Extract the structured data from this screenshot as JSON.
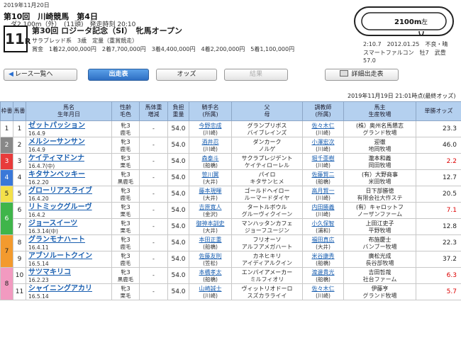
{
  "header": {
    "date": "2019年11月20日",
    "line1_main": "第10回　川崎競馬　第4日",
    "line1_sub": "ダ2,100m（外）　(11頭)　発走時刻 20:10",
    "race_number": "11",
    "race_suffix": "R",
    "race_name": "第30回 ロジータ記念（SⅠ）　牝馬オープン",
    "conditions": "サラブレッド系　3歳　定量（重賞競走）",
    "prize": "賞金　1着22,000,000円　2着7,700,000円　3着4,400,000円　4着2,200,000円　5着1,100,000円"
  },
  "course": {
    "distance": "2100m",
    "direction": "左",
    "record_lines": [
      "2:10.7　2012.01.25　不良・晴",
      "スマートファルコン　牡7　武豊",
      "57.0"
    ]
  },
  "toolbar": {
    "back": "レース一覧へ",
    "entries": "出走表",
    "odds": "オッズ",
    "results": "結果",
    "print": "詳細出走表"
  },
  "updated": "2019年11月19日 21:01時点(最終オッズ)",
  "colors": {
    "header_bg": "#b4d0ef",
    "link": "#1a5fb0",
    "odds_red": "#d00000",
    "waku": [
      "#ffffff",
      "#888888",
      "#e83b3b",
      "#3a78d8",
      "#f4e14a",
      "#3fb54a",
      "#f39a2e",
      "#f29ac0"
    ]
  },
  "columns": [
    "枠番",
    "馬番",
    "馬名\n生年月日",
    "性齢\n毛色",
    "馬体重\n増減",
    "負担\n重量",
    "騎手名\n(所属)",
    "父\n母",
    "調教師\n(所属)",
    "馬主\n生産牧場",
    "単勝オッズ"
  ],
  "rows": [
    {
      "waku": "1",
      "num": "1",
      "name": "ゼットパッション",
      "birth": "16.4.9",
      "sex": "牝3",
      "coat": "鹿毛",
      "wt": "-",
      "load": "54.0",
      "jockey": "今野忠成",
      "jaff": "(川崎)",
      "sire": "グランプリボス",
      "dam": "バイブレインズ",
      "trainer": "佐々木仁",
      "taff": "(川崎)",
      "owner": "(株）奥州名馬懇志",
      "breeder": "グランド牧場",
      "odds": "23.3",
      "red": false
    },
    {
      "waku": "2",
      "num": "2",
      "name": "メルシーサンサン",
      "birth": "16.4.9",
      "sex": "牝3",
      "coat": "鹿毛",
      "wt": "-",
      "load": "54.0",
      "jockey": "酒井忍",
      "jaff": "(川崎)",
      "sire": "ダンカーク",
      "dam": "ノルゲ",
      "trainer": "小澤宏次",
      "taff": "(川崎)",
      "owner": "迎徹",
      "breeder": "地岡牧場",
      "odds": "46.0",
      "red": false
    },
    {
      "waku": "3",
      "num": "3",
      "name": "ケイティマドンナ",
      "birth": "16.4.7(中)",
      "sex": "牝3",
      "coat": "栗毛",
      "wt": "-",
      "load": "54.0",
      "jockey": "森泰斗",
      "jaff": "(船橋)",
      "sire": "サクラプレジデント",
      "dam": "ケイティローレル",
      "trainer": "堀千亜樹",
      "taff": "(川崎)",
      "owner": "瀧本和義",
      "breeder": "岡田牧場",
      "odds": "2.2",
      "red": true
    },
    {
      "waku": "4",
      "num": "4",
      "name": "キタサンベッキー",
      "birth": "16.2.20",
      "sex": "牝3",
      "coat": "黒鹿毛",
      "wt": "-",
      "load": "54.0",
      "jockey": "笹川翼",
      "jaff": "(大井)",
      "sire": "パイロ",
      "dam": "キタサンヒメ",
      "trainer": "佐藤賢二",
      "taff": "(船橋)",
      "owner": "(有）大野商事",
      "breeder": "米田牧場",
      "odds": "12.7",
      "red": false
    },
    {
      "waku": "5",
      "num": "5",
      "name": "グローリアスライブ",
      "birth": "16.4.20",
      "sex": "牝3",
      "coat": "鹿毛",
      "wt": "-",
      "load": "54.0",
      "jockey": "藤本現暉",
      "jaff": "(大井)",
      "sire": "ゴールドヘイロー",
      "dam": "ルーマードダイヤ",
      "trainer": "高月賢一",
      "taff": "(川崎)",
      "owner": "日下部勝徳",
      "breeder": "有限会社大作ステ",
      "odds": "20.5",
      "red": false
    },
    {
      "waku": "6",
      "num": "6",
      "name": "リトミックグルーヴ",
      "birth": "16.4.2",
      "sex": "牝3",
      "coat": "栗毛",
      "wt": "-",
      "load": "54.0",
      "jockey": "吉原寛人",
      "jaff": "(金沢)",
      "sire": "タートルボウル",
      "dam": "グルーヴィクイーン",
      "trainer": "内田勝義",
      "taff": "(川崎)",
      "owner": "(有）キャロットフ",
      "breeder": "ノーザンファーム",
      "odds": "7.1",
      "red": true
    },
    {
      "waku": "6",
      "num": "7",
      "name": "ジョースイーツ",
      "birth": "16.3.14(中)",
      "sex": "牝3",
      "coat": "栗毛",
      "wt": "-",
      "load": "54.0",
      "jockey": "御神本訓史",
      "jaff": "(大井)",
      "sire": "マンハッタンカフェ",
      "dam": "ジョーフユージン",
      "trainer": "小久保智",
      "taff": "(浦和)",
      "owner": "上田江吏子",
      "breeder": "平野牧場",
      "odds": "12.8",
      "red": false
    },
    {
      "waku": "7",
      "num": "8",
      "name": "グランモナハート",
      "birth": "16.4.11",
      "sex": "牝3",
      "coat": "鹿毛",
      "wt": "-",
      "load": "54.0",
      "jockey": "本田正重",
      "jaff": "(船橋)",
      "sire": "フリオーソ",
      "dam": "アルフアメガハート",
      "trainer": "福田真広",
      "taff": "(大井)",
      "owner": "布施慶士",
      "breeder": "バンブー牧場",
      "odds": "22.3",
      "red": false
    },
    {
      "waku": "7",
      "num": "9",
      "name": "アブソルートクイン",
      "birth": "16.5.14",
      "sex": "牝3",
      "coat": "鹿毛",
      "wt": "-",
      "load": "54.0",
      "jockey": "佐藤友則",
      "jaff": "(笠松)",
      "sire": "カネヒキリ",
      "dam": "アイディアルクイン",
      "trainer": "米谷康秀",
      "taff": "(船橋)",
      "owner": "廣松光成",
      "breeder": "長谷部牧場",
      "odds": "37.2",
      "red": false
    },
    {
      "waku": "8",
      "num": "10",
      "name": "サツマキリコ",
      "birth": "16.2.23",
      "sex": "牝3",
      "coat": "黒鹿毛",
      "wt": "-",
      "load": "54.0",
      "jockey": "本橋孝太",
      "jaff": "(船橋)",
      "sire": "エンパイアメーカー",
      "dam": "ミルフィオリ",
      "trainer": "渡邊貴光",
      "taff": "(船橋)",
      "owner": "吉田哲哉",
      "breeder": "社台ファーム",
      "odds": "6.3",
      "red": true
    },
    {
      "waku": "8",
      "num": "11",
      "name": "シャイニングアカリ",
      "birth": "16.5.14",
      "sex": "牝3",
      "coat": "栗毛",
      "wt": "-",
      "load": "54.0",
      "jockey": "山崎誠士",
      "jaff": "(川崎)",
      "sire": "ヴィットリオドーロ",
      "dam": "スズカラライイ",
      "trainer": "佐々木仁",
      "taff": "(川崎)",
      "owner": "伊藤亨",
      "breeder": "グランド牧場",
      "odds": "5.7",
      "red": true
    }
  ]
}
